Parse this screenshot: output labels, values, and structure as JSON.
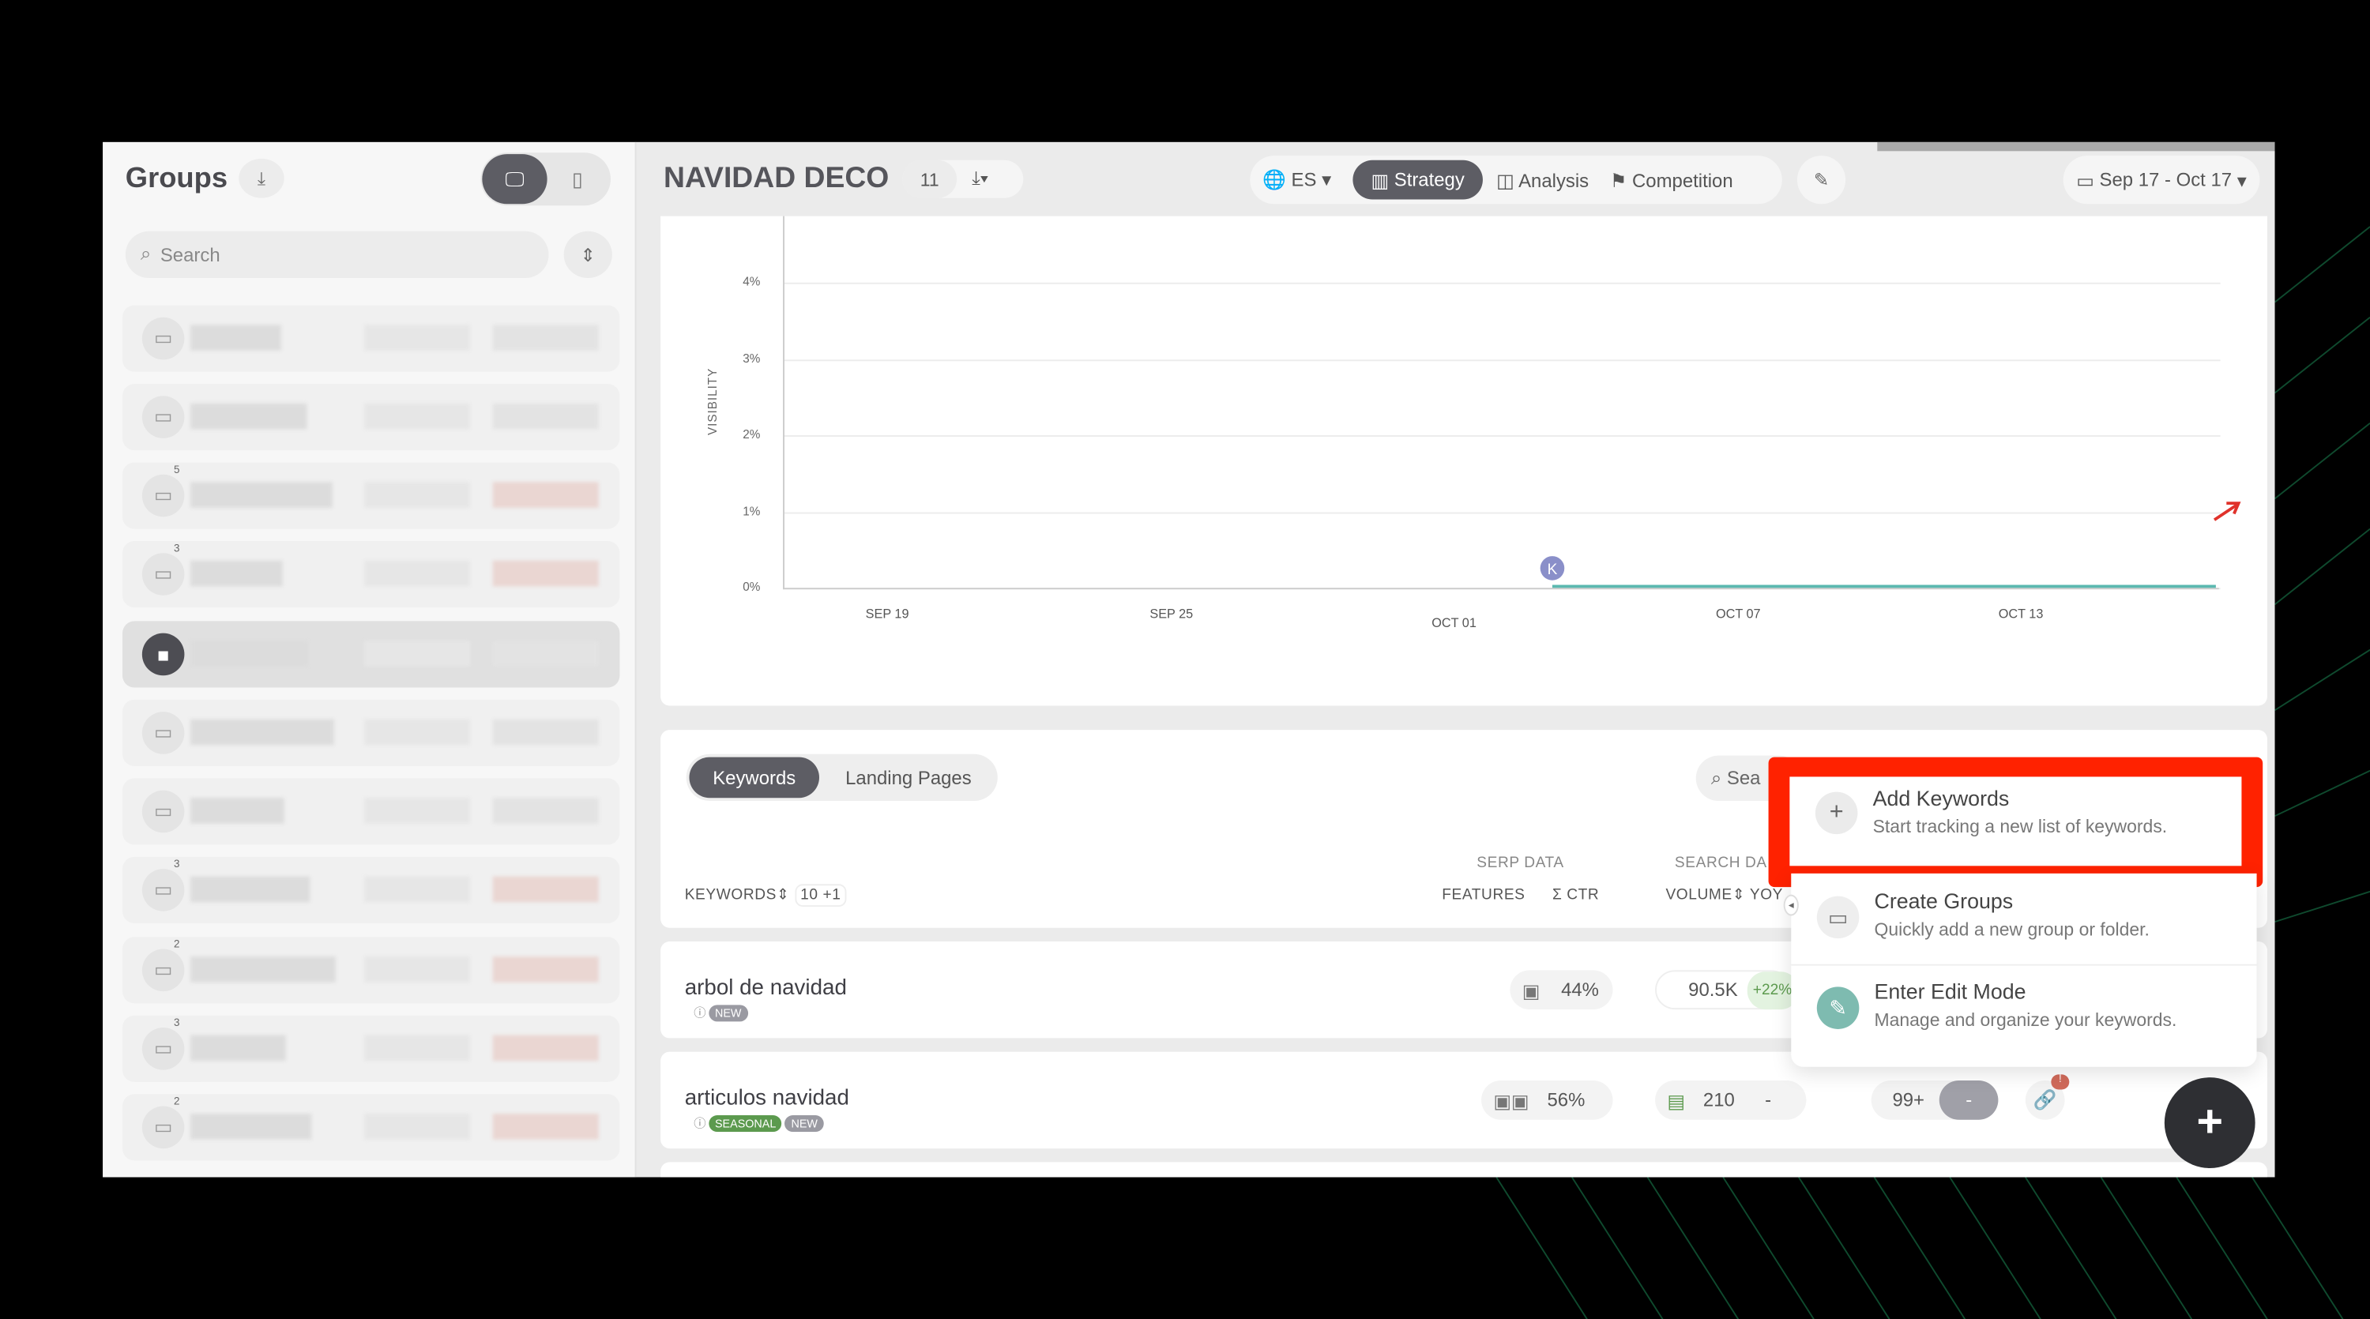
{
  "sidebar": {
    "title": "Groups",
    "search_placeholder": "Search",
    "group_badges": [
      "",
      "",
      "5",
      "3",
      "",
      "",
      "",
      "3",
      "2",
      "3",
      "2"
    ],
    "selected_index": 4
  },
  "header": {
    "title": "NAVIDAD DECO",
    "count": "11",
    "language": "ES",
    "tabs": [
      {
        "label": "Strategy",
        "active": true
      },
      {
        "label": "Analysis"
      },
      {
        "label": "Competition"
      }
    ],
    "date_range": "Sep 17 - Oct 17"
  },
  "chart_data": {
    "type": "line",
    "ylabel": "VISIBILITY",
    "yticks": [
      "0%",
      "1%",
      "2%",
      "3%",
      "4%"
    ],
    "ylim": [
      0,
      4.4
    ],
    "xticks": [
      "SEP 19",
      "SEP 25",
      "OCT 01",
      "OCT 07",
      "OCT 13"
    ],
    "series": [
      {
        "values_note": "",
        "x": [
          "OCT 04",
          "OCT 17"
        ],
        "y": [
          0,
          0
        ]
      }
    ],
    "marker_label": "K",
    "colors": {
      "line": "#5bb8b0",
      "marker": "#8a8fc9",
      "trend": "#e0322b"
    }
  },
  "keywords": {
    "tabs": [
      {
        "label": "Keywords",
        "active": true
      },
      {
        "label": "Landing Pages"
      }
    ],
    "search_placeholder": "Sea",
    "groups": {
      "serp": "SERP DATA",
      "search": "SEARCH DA"
    },
    "columns": {
      "keywords": "KEYWORDS",
      "count": "10",
      "plus": "+1",
      "features": "FEATURES",
      "ctr": "Σ CTR",
      "volume": "VOLUME",
      "yoy": "YOY"
    },
    "rows": [
      {
        "keyword": "arbol de navidad",
        "tags": [
          "NEW"
        ],
        "ctr": "44%",
        "volume": "90.5K",
        "yoy": "+22%"
      },
      {
        "keyword": "articulos navidad",
        "tags": [
          "SEASONAL",
          "NEW"
        ],
        "ctr": "56%",
        "volume": "210",
        "yoy": "-",
        "rank": "99+",
        "rank_change": "-"
      }
    ]
  },
  "menu": {
    "items": [
      {
        "title": "Add Keywords",
        "desc": "Start tracking a new list of keywords."
      },
      {
        "title": "Create Groups",
        "desc": "Quickly add a new group or folder."
      },
      {
        "title": "Enter Edit Mode",
        "desc": "Manage and organize your keywords."
      }
    ]
  },
  "colors": {
    "highlight": "#ff2200",
    "seasonal": "#5c9a4e",
    "new": "#9a9aa2"
  }
}
